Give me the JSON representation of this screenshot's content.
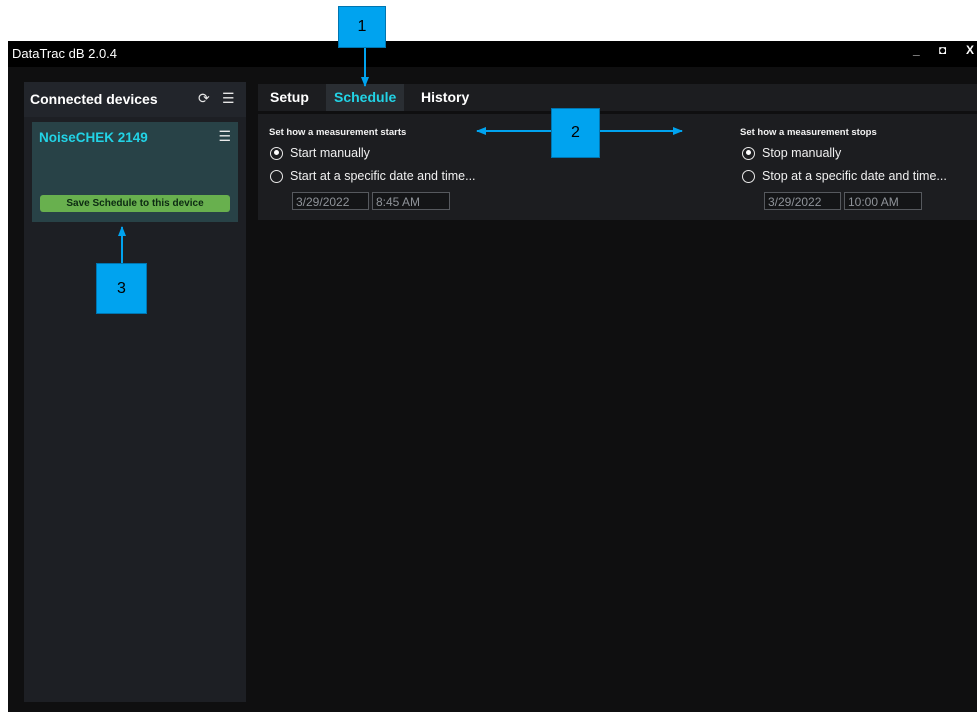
{
  "window": {
    "title": "DataTrac dB 2.0.4",
    "buttons": {
      "minimize": "_",
      "maximize": "◘",
      "close": "X"
    }
  },
  "sidebar": {
    "title": "Connected devices",
    "refresh_icon": "⟳",
    "menu_icon": "☰",
    "device": {
      "name": "NoiseCHEK 2149",
      "menu_icon": "☰",
      "save_button": "Save Schedule to this device"
    }
  },
  "tabs": [
    {
      "label": "Setup",
      "active": false
    },
    {
      "label": "Schedule",
      "active": true
    },
    {
      "label": "History",
      "active": false
    }
  ],
  "schedule": {
    "start": {
      "title": "Set how a measurement starts",
      "option_manual": "Start manually",
      "option_specific": "Start at a specific date and time...",
      "selected": "manual",
      "date": "3/29/2022",
      "time": "8:45 AM"
    },
    "stop": {
      "title": "Set how a measurement stops",
      "option_manual": "Stop manually",
      "option_specific": "Stop at a specific date and time...",
      "selected": "manual",
      "date": "3/29/2022",
      "time": "10:00 AM"
    }
  },
  "callouts": {
    "c1": "1",
    "c2": "2",
    "c3": "3"
  },
  "colors": {
    "accent": "#22d3e6",
    "save_button": "#68b04e",
    "callout": "#00a3ef",
    "background": "#0f0f10"
  }
}
